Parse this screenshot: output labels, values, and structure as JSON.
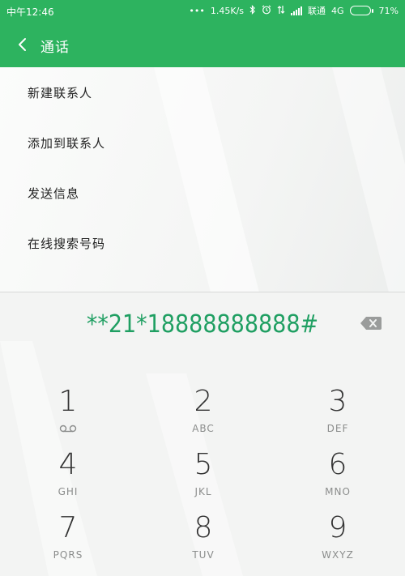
{
  "status": {
    "time": "中午12:46",
    "speed": "1.45K/s",
    "carrier": "联通",
    "network": "4G",
    "battery": "71%",
    "battery_level": 0.71,
    "battery_color": "#f2b01f"
  },
  "appbar": {
    "title": "通话",
    "color": "#2db35f"
  },
  "menu": {
    "items": [
      {
        "label": "新建联系人"
      },
      {
        "label": "添加到联系人"
      },
      {
        "label": "发送信息"
      },
      {
        "label": "在线搜索号码"
      }
    ]
  },
  "dialpad": {
    "number": "**21*18888888888#",
    "number_color": "#1f9f62",
    "keys": [
      {
        "digit": "1",
        "letters": "",
        "icon": "voicemail-icon"
      },
      {
        "digit": "2",
        "letters": "ABC"
      },
      {
        "digit": "3",
        "letters": "DEF"
      },
      {
        "digit": "4",
        "letters": "GHI"
      },
      {
        "digit": "5",
        "letters": "JKL"
      },
      {
        "digit": "6",
        "letters": "MNO"
      },
      {
        "digit": "7",
        "letters": "PQRS"
      },
      {
        "digit": "8",
        "letters": "TUV"
      },
      {
        "digit": "9",
        "letters": "WXYZ"
      }
    ]
  }
}
